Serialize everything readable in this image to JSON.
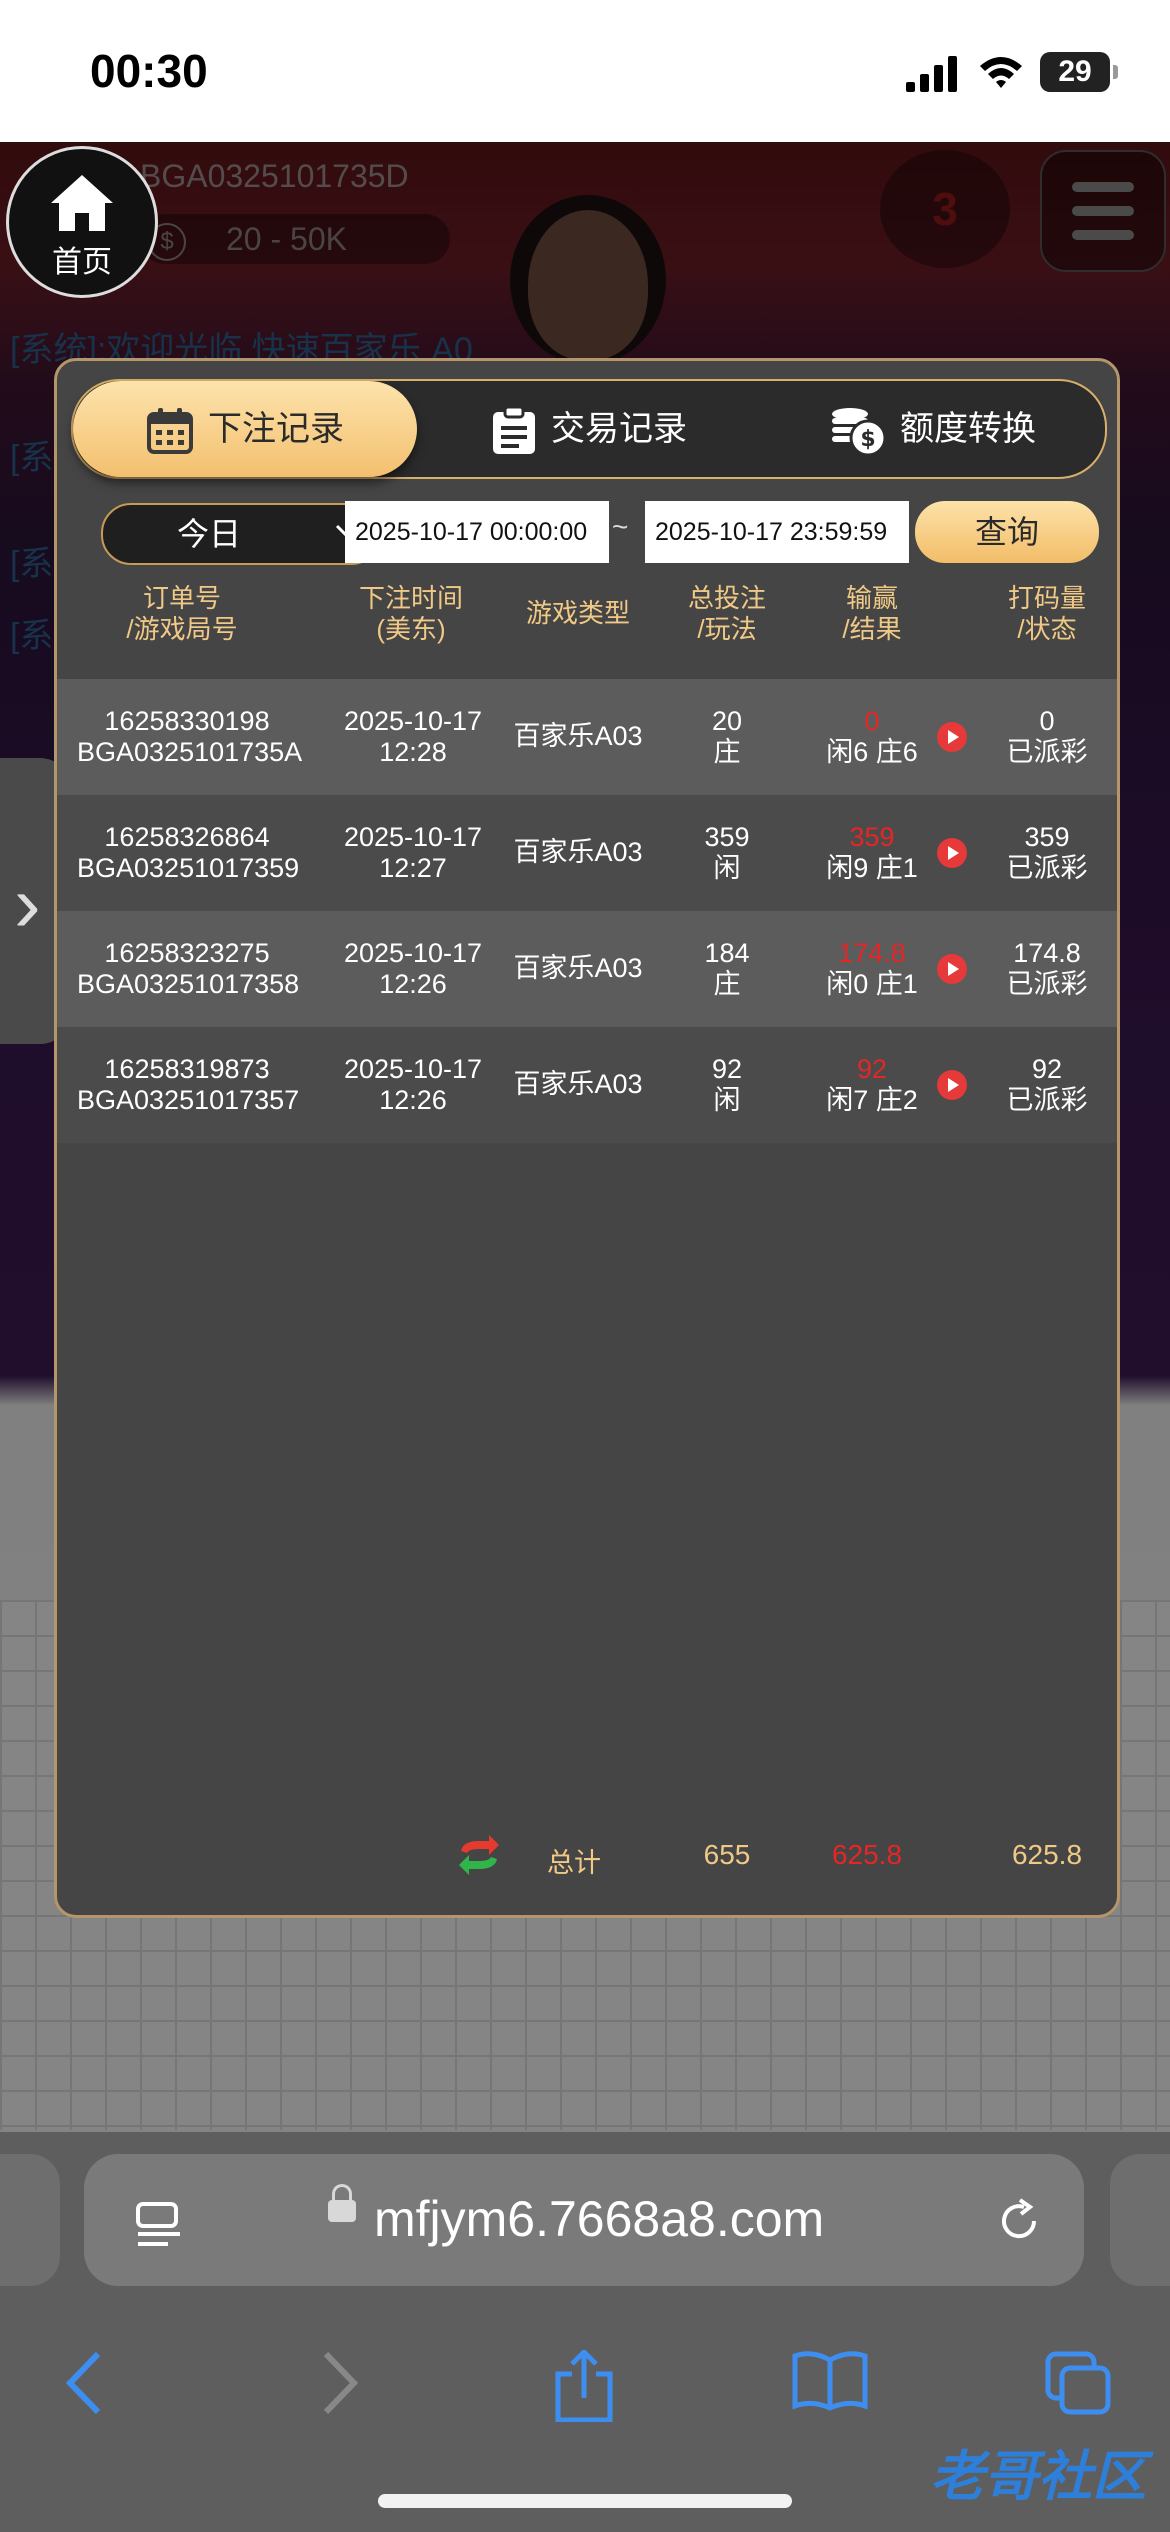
{
  "status_bar": {
    "time": "00:30",
    "battery": "29"
  },
  "background": {
    "home_label": "首页",
    "table_id": "BGA0325101735D",
    "limit": "20 - 50K",
    "countdown": "3",
    "system_message": "[系统]:欢迎光临 快速百家乐 A0",
    "system_msg_2": "[系",
    "system_msg_3": "[系",
    "system_msg_4": "[系"
  },
  "modal": {
    "tabs": [
      {
        "label": "下注记录",
        "icon": "calendar-icon",
        "active": true
      },
      {
        "label": "交易记录",
        "icon": "clipboard-icon",
        "active": false
      },
      {
        "label": "额度转换",
        "icon": "coins-icon",
        "active": false
      }
    ],
    "filter": {
      "period": "今日",
      "start": "2025-10-17 00:00:00",
      "separator": "~",
      "end": "2025-10-17 23:59:59",
      "query_label": "查询"
    },
    "headers": [
      {
        "l1": "订单号",
        "l2": "/游戏局号"
      },
      {
        "l1": "下注时间",
        "l2": "(美东)"
      },
      {
        "l1": "游戏类型",
        "l2": ""
      },
      {
        "l1": "总投注",
        "l2": "/玩法"
      },
      {
        "l1": "输赢",
        "l2": "/结果"
      },
      {
        "l1": "打码量",
        "l2": "/状态"
      }
    ],
    "rows": [
      {
        "order": "16258330198",
        "round": "BGA0325101735A",
        "date": "2025-10-17",
        "time": "12:28",
        "game": "百家乐A03",
        "bet": "20",
        "play": "庄",
        "win": "0",
        "result": "闲6 庄6",
        "turnover": "0",
        "status": "已派彩"
      },
      {
        "order": "16258326864",
        "round": "BGA03251017359",
        "date": "2025-10-17",
        "time": "12:27",
        "game": "百家乐A03",
        "bet": "359",
        "play": "闲",
        "win": "359",
        "result": "闲9 庄1",
        "turnover": "359",
        "status": "已派彩"
      },
      {
        "order": "16258323275",
        "round": "BGA03251017358",
        "date": "2025-10-17",
        "time": "12:26",
        "game": "百家乐A03",
        "bet": "184",
        "play": "庄",
        "win": "174.8",
        "result": "闲0 庄1",
        "turnover": "174.8",
        "status": "已派彩"
      },
      {
        "order": "16258319873",
        "round": "BGA03251017357",
        "date": "2025-10-17",
        "time": "12:26",
        "game": "百家乐A03",
        "bet": "92",
        "play": "闲",
        "win": "92",
        "result": "闲7 庄2",
        "turnover": "92",
        "status": "已派彩"
      }
    ],
    "summary": {
      "label": "总计",
      "bet": "655",
      "win": "625.8",
      "turnover": "625.8"
    }
  },
  "browser": {
    "url": "mfjym6.7668a8.com"
  },
  "watermark": "老哥社区",
  "colors": {
    "accent_gold": "#f3c06f",
    "win_red": "#e52626",
    "border_gold": "#b5956a"
  }
}
